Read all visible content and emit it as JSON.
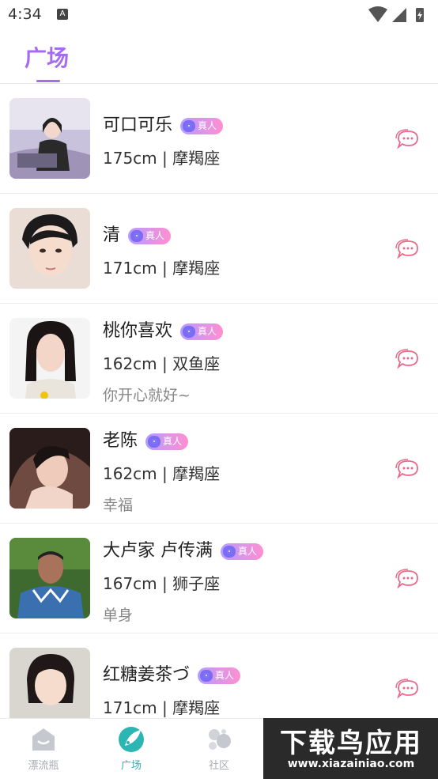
{
  "status_bar": {
    "time": "4:34",
    "notification_letter": "A"
  },
  "header": {
    "active_tab": "广场"
  },
  "badge_label": "真人",
  "users": [
    {
      "name": "可口可乐",
      "info": "175cm | 摩羯座",
      "signature": ""
    },
    {
      "name": "清",
      "info": "171cm | 摩羯座",
      "signature": ""
    },
    {
      "name": "桃你喜欢",
      "info": "162cm | 双鱼座",
      "signature": "你开心就好~"
    },
    {
      "name": "老陈",
      "info": "162cm | 摩羯座",
      "signature": "幸福"
    },
    {
      "name": "大卢家 卢传满",
      "info": "167cm | 狮子座",
      "signature": "单身"
    },
    {
      "name": "红糖姜茶づ",
      "info": "171cm | 摩羯座",
      "signature": ""
    }
  ],
  "bottom_nav": [
    {
      "label": "漂流瓶"
    },
    {
      "label": "广场"
    },
    {
      "label": "社区"
    }
  ],
  "watermark": {
    "title": "下载鸟应用",
    "url": "www.xiazainiao.com"
  },
  "colors": {
    "accent": "#a46cf0",
    "nav_active": "#2bb5b3",
    "chat_icon": "#e86a8a"
  }
}
